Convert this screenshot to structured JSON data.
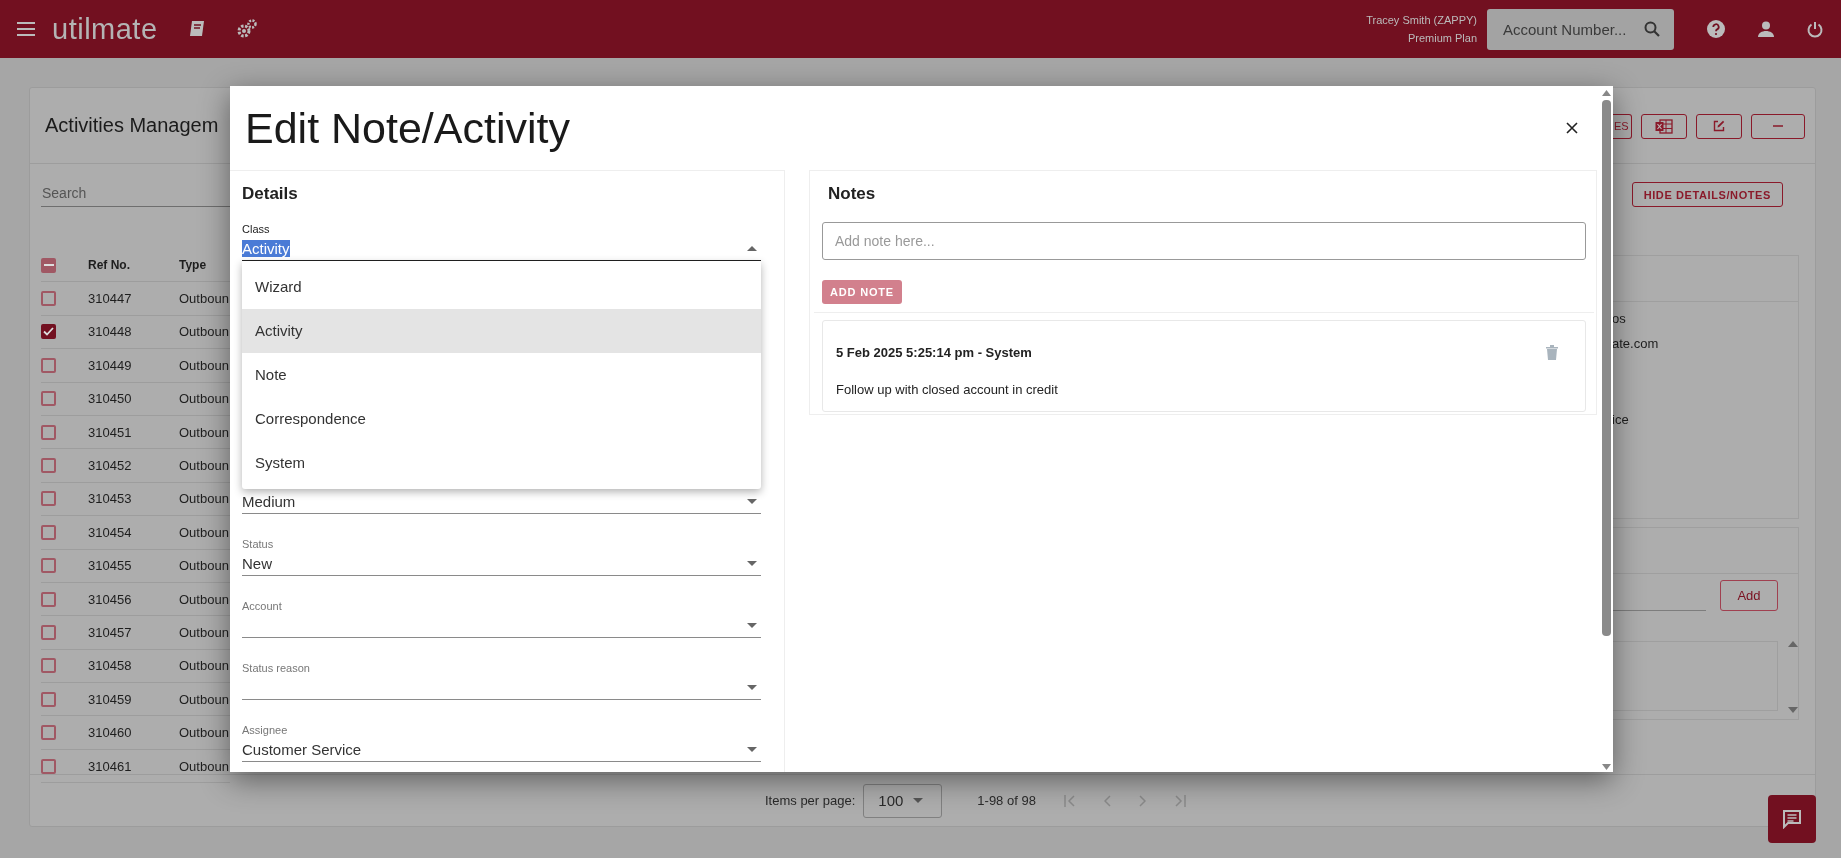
{
  "app_bar": {
    "logo": "utilmate",
    "user_name": "Tracey Smith (ZAPPY)",
    "plan": "Premium Plan",
    "search_placeholder": "Account Number..."
  },
  "page": {
    "title": "Activities Managem",
    "search_placeholder": "Search",
    "toolbar_buttons": [
      {
        "kind": "text",
        "label": "ES"
      },
      {
        "kind": "excel"
      },
      {
        "kind": "edit"
      },
      {
        "kind": "collapse"
      }
    ],
    "hide_button": "HIDE DETAILS/NOTES",
    "table": {
      "select_all": {
        "indeterminate": true
      },
      "columns": [
        "Ref No.",
        "Type"
      ],
      "rows": [
        {
          "ref": "310447",
          "type": "Outboun",
          "checked": false
        },
        {
          "ref": "310448",
          "type": "Outboun",
          "checked": true
        },
        {
          "ref": "310449",
          "type": "Outboun",
          "checked": false
        },
        {
          "ref": "310450",
          "type": "Outboun",
          "checked": false
        },
        {
          "ref": "310451",
          "type": "Outboun",
          "checked": false
        },
        {
          "ref": "310452",
          "type": "Outboun",
          "checked": false
        },
        {
          "ref": "310453",
          "type": "Outboun",
          "checked": false
        },
        {
          "ref": "310454",
          "type": "Outboun",
          "checked": false
        },
        {
          "ref": "310455",
          "type": "Outboun",
          "checked": false
        },
        {
          "ref": "310456",
          "type": "Outboun",
          "checked": false
        },
        {
          "ref": "310457",
          "type": "Outboun",
          "checked": false
        },
        {
          "ref": "310458",
          "type": "Outboun",
          "checked": false
        },
        {
          "ref": "310459",
          "type": "Outboun",
          "checked": false
        },
        {
          "ref": "310460",
          "type": "Outboun",
          "checked": false
        },
        {
          "ref": "310461",
          "type": "Outboun",
          "checked": false
        }
      ]
    },
    "details_lines": [
      "os",
      "ate.com",
      "ice"
    ],
    "add_button": "Add",
    "pagination": {
      "label": "Items per page:",
      "page_size": "100",
      "range": "1-98 of 98"
    }
  },
  "modal": {
    "title": "Edit Note/Activity",
    "details": {
      "heading": "Details",
      "fields": [
        {
          "label": "Class",
          "value": "Activity",
          "open": true
        },
        {
          "value": "Medium",
          "open": false
        },
        {
          "label": "Status",
          "value": "New",
          "open": false
        },
        {
          "label": "Account",
          "open": false
        },
        {
          "label": "Status reason",
          "open": false
        },
        {
          "label": "Assignee",
          "value": "Customer Service",
          "open": false
        }
      ]
    },
    "class_options": [
      {
        "label": "Wizard",
        "selected": false
      },
      {
        "label": "Activity",
        "selected": true
      },
      {
        "label": "Note",
        "selected": false
      },
      {
        "label": "Correspondence",
        "selected": false
      },
      {
        "label": "System",
        "selected": false
      }
    ],
    "notes": {
      "heading": "Notes",
      "placeholder": "Add note here...",
      "add_button": "ADD NOTE",
      "entries": [
        {
          "header": "5 Feb 2025 5:25:14 pm - System",
          "text": "Follow up with closed account in credit"
        }
      ]
    }
  }
}
